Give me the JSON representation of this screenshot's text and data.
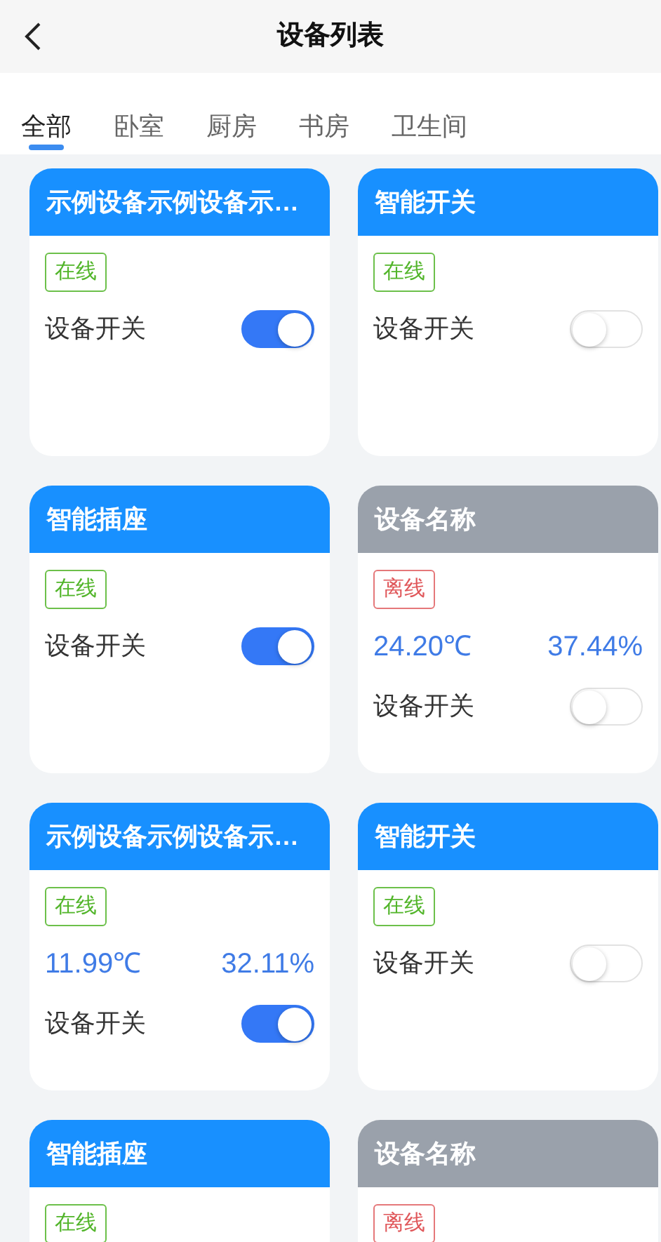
{
  "header": {
    "title": "设备列表"
  },
  "tabs": [
    {
      "label": "全部",
      "selected": true
    },
    {
      "label": "卧室",
      "selected": false
    },
    {
      "label": "厨房",
      "selected": false
    },
    {
      "label": "书房",
      "selected": false
    },
    {
      "label": "卫生间",
      "selected": false
    }
  ],
  "devices": [
    {
      "name": "示例设备示例设备示…",
      "status": {
        "label": "在线",
        "kind": "online"
      },
      "switch": {
        "label": "设备开关",
        "on": true
      }
    },
    {
      "name": "智能开关",
      "status": {
        "label": "在线",
        "kind": "online"
      },
      "switch": {
        "label": "设备开关",
        "on": false
      }
    },
    {
      "name": "智能插座",
      "status": {
        "label": "在线",
        "kind": "online"
      },
      "switch": {
        "label": "设备开关",
        "on": true
      }
    },
    {
      "name": "设备名称",
      "status": {
        "label": "离线",
        "kind": "offline"
      },
      "sensor": {
        "temperature": "24.20℃",
        "humidity": "37.44%"
      },
      "switch": {
        "label": "设备开关",
        "on": false
      }
    },
    {
      "name": "示例设备示例设备示…",
      "status": {
        "label": "在线",
        "kind": "online"
      },
      "sensor": {
        "temperature": "11.99℃",
        "humidity": "32.11%"
      },
      "switch": {
        "label": "设备开关",
        "on": true
      }
    },
    {
      "name": "智能开关",
      "status": {
        "label": "在线",
        "kind": "online"
      },
      "switch": {
        "label": "设备开关",
        "on": false
      }
    },
    {
      "name": "智能插座",
      "status": {
        "label": "在线",
        "kind": "online"
      }
    },
    {
      "name": "设备名称",
      "status": {
        "label": "离线",
        "kind": "offline"
      }
    }
  ]
}
